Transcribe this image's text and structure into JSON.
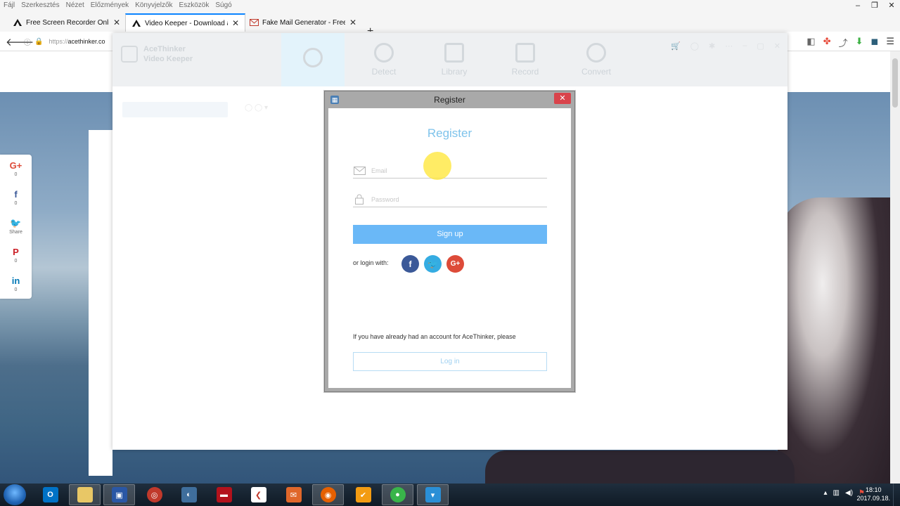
{
  "browser": {
    "menu": [
      "Fájl",
      "Szerkesztés",
      "Nézet",
      "Előzmények",
      "Könyvjelzők",
      "Eszközök",
      "Súgó"
    ],
    "tabs": [
      {
        "title": "Free Screen Recorder Online"
      },
      {
        "title": "Video Keeper - Download a"
      },
      {
        "title": "Fake Mail Generator - Free t"
      }
    ],
    "url_scheme": "https://",
    "url_host": "acethinker.co"
  },
  "share": [
    {
      "icon": "G+",
      "count": "0",
      "color": "#dd4b39"
    },
    {
      "icon": "f",
      "count": "0",
      "color": "#3b5998"
    },
    {
      "icon": "🐦",
      "count": "Share",
      "color": "#1da1f2"
    },
    {
      "icon": "P",
      "count": "0",
      "color": "#cb2027"
    },
    {
      "icon": "in",
      "count": "0",
      "color": "#0077b5"
    }
  ],
  "app": {
    "brand_line1": "AceThinker",
    "brand_line2": "Video Keeper",
    "nav": [
      "",
      "Detect",
      "Library",
      "Record",
      "Convert"
    ]
  },
  "dialog": {
    "window_title": "Register",
    "heading": "Register",
    "email_placeholder": "Email",
    "password_placeholder": "Password",
    "signup_label": "Sign up",
    "or_login": "or login with:",
    "already_text": "If you have already had an account for AceThinker, please",
    "login_label": "Log in"
  },
  "colors": {
    "facebook": "#3b5998",
    "twitter": "#35ace2",
    "google": "#dd4b39",
    "signup": "#6ab8f7"
  },
  "taskbar": {
    "time": "18:10",
    "date": "2017.09.18."
  }
}
